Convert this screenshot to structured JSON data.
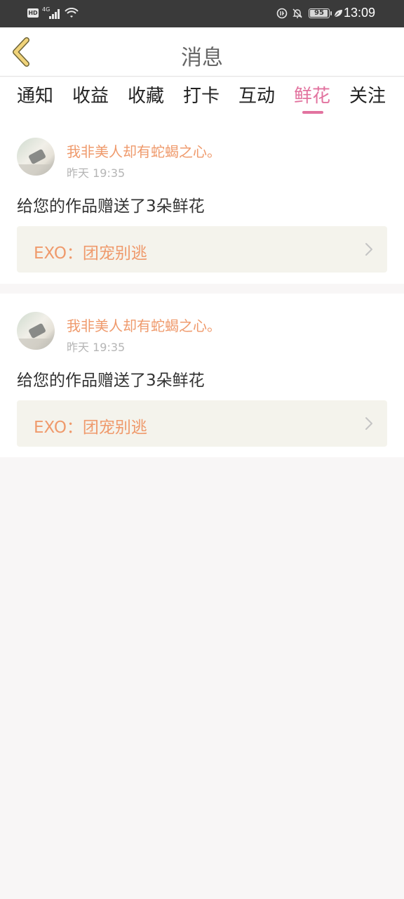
{
  "status_bar": {
    "hd": "HD",
    "network": "4G",
    "battery": "95",
    "time": "13:09",
    "icons": [
      "hd-icon",
      "signal-icon",
      "wifi-icon",
      "data-saver-icon",
      "bell-off-icon",
      "battery-icon",
      "leaf-icon"
    ]
  },
  "header": {
    "title": "消息",
    "back_icon": "chevron-left-icon"
  },
  "tabs": [
    {
      "label": "通知",
      "active": false
    },
    {
      "label": "收益",
      "active": false
    },
    {
      "label": "收藏",
      "active": false
    },
    {
      "label": "打卡",
      "active": false
    },
    {
      "label": "互动",
      "active": false
    },
    {
      "label": "鲜花",
      "active": true
    },
    {
      "label": "关注",
      "active": false
    }
  ],
  "notifications": [
    {
      "username": "我非美人却有蛇蝎之心。",
      "time": "昨天 19:35",
      "message": "给您的作品赠送了3朵鲜花",
      "work": "EXO：团宠别逃"
    },
    {
      "username": "我非美人却有蛇蝎之心。",
      "time": "昨天 19:35",
      "message": "给您的作品赠送了3朵鲜花",
      "work": "EXO：团宠别逃"
    }
  ],
  "colors": {
    "accent": "#e2739f",
    "username": "#ef9a6c",
    "back_arrow": "#f0d37a",
    "status_bar": "#3a3a3a",
    "card_link_bg": "#f4f3ec"
  }
}
